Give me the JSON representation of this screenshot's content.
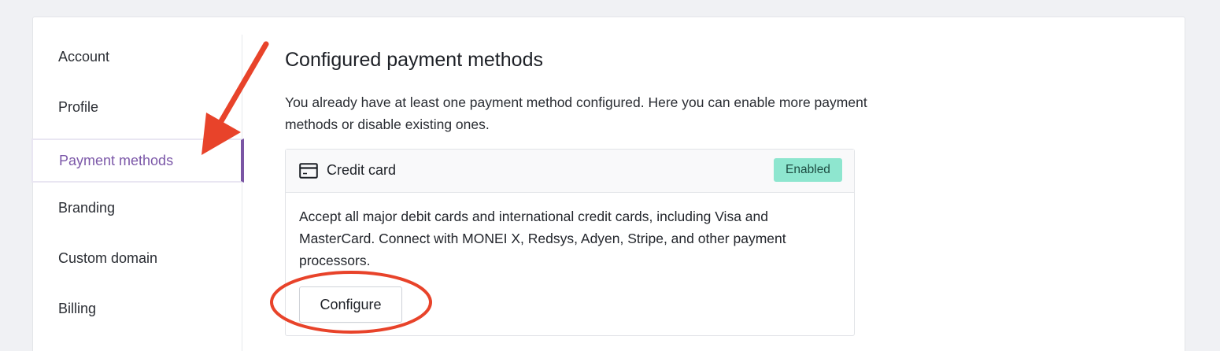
{
  "sidebar": {
    "items": [
      {
        "label": "Account"
      },
      {
        "label": "Profile"
      },
      {
        "label": "Payment methods",
        "active": true
      },
      {
        "label": "Branding"
      },
      {
        "label": "Custom domain"
      },
      {
        "label": "Billing"
      }
    ]
  },
  "main": {
    "title": "Configured payment methods",
    "description": "You already have at least one payment method configured. Here you can enable more payment methods or disable existing ones.",
    "card": {
      "icon": "credit-card-icon",
      "title": "Credit card",
      "status": "Enabled",
      "status_color": "#8ee6cf",
      "body": "Accept all major debit cards and international credit cards, including Visa and MasterCard. Connect with MONEI X, Redsys, Adyen, Stripe, and other payment processors.",
      "button_label": "Configure"
    }
  },
  "annotations": {
    "arrow_color": "#e8432a",
    "highlight_color": "#e8432a"
  },
  "colors": {
    "accent": "#7a55a4",
    "background": "#f0f1f4"
  }
}
